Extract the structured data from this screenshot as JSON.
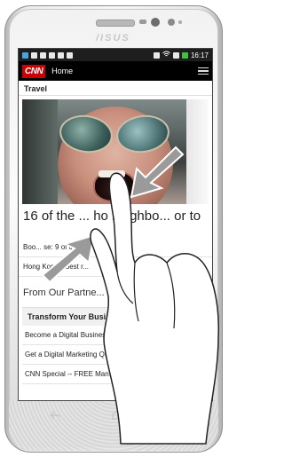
{
  "device": {
    "brand_text": "/ISUS"
  },
  "statusbar": {
    "time": "16:17",
    "left_icons": [
      "sim-icon",
      "battery-saver-icon",
      "image-icon",
      "shield-icon",
      "sync-icon",
      "document-icon"
    ],
    "right_icons": [
      "vibrate-icon",
      "wifi-icon",
      "signal-icon",
      "battery-charging-icon"
    ]
  },
  "appbar": {
    "logo": "CNN",
    "title": "Home",
    "menu_icon": "hamburger-menu-icon"
  },
  "section": {
    "label": "Travel"
  },
  "story": {
    "headline": "16 of the ... ho neighbo... or to",
    "link1": "Boo... se: 9 of th...",
    "link2": "Hong Kong's best r..."
  },
  "partners": {
    "heading": "From Our Partne...",
    "box_title": "Transform Your Busi...",
    "links": [
      "Become a Digital Business",
      "Get a Digital Marketing Qu...",
      "CNN Special -- FREE Man..."
    ]
  },
  "nav": {
    "back_icon": "back-icon",
    "home_icon": "home-icon",
    "recents_icon": "recents-icon"
  },
  "gesture": {
    "type": "pinch-zoom",
    "hand_icon": "hand-pinch-icon",
    "arrow_icons": [
      "arrow-inward-top-right-icon",
      "arrow-inward-bottom-left-icon"
    ]
  }
}
